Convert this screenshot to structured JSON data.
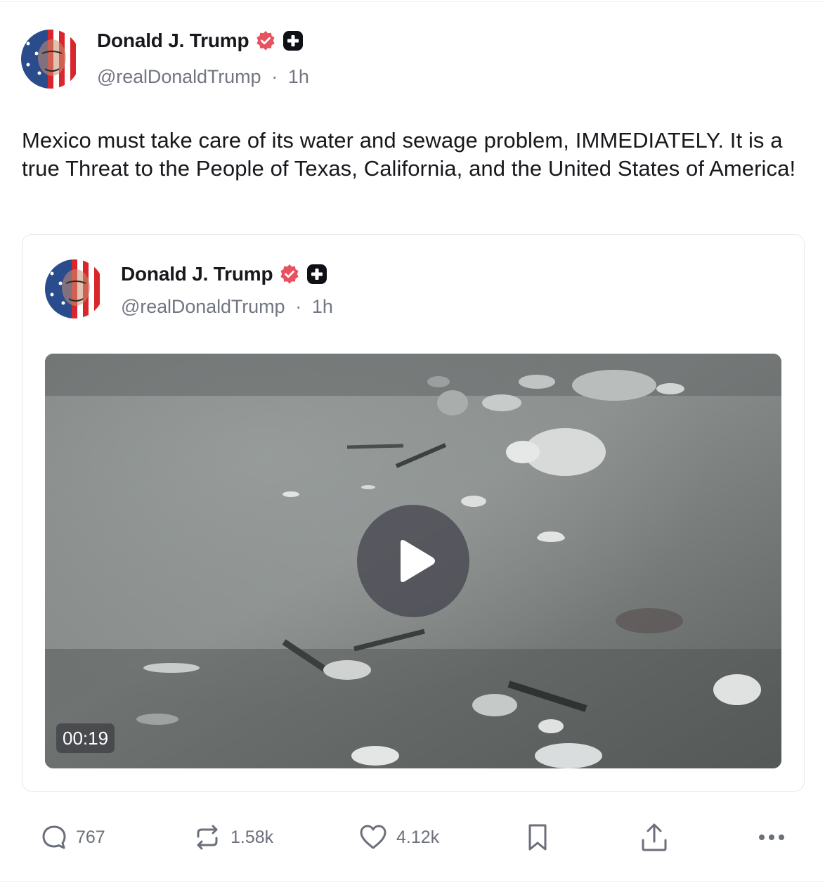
{
  "post": {
    "author_name": "Donald J. Trump",
    "handle": "@realDonaldTrump",
    "separator": "·",
    "time": "1h",
    "text": "Mexico must take care of its water and sewage problem, IMMEDIATELY. It is a true Threat to the People of Texas, California, and the United States of America!",
    "avatar_icon": "flag-face-avatar",
    "verified_icon": "verified-badge-icon",
    "plus_icon": "plus-badge-icon"
  },
  "quoted_post": {
    "author_name": "Donald J. Trump",
    "handle": "@realDonaldTrump",
    "separator": "·",
    "time": "1h",
    "video": {
      "duration": "00:19",
      "play_icon": "play-icon"
    }
  },
  "actions": {
    "replies": {
      "icon": "reply-icon",
      "count": "767"
    },
    "reposts": {
      "icon": "repost-icon",
      "count": "1.58k"
    },
    "likes": {
      "icon": "heart-icon",
      "count": "4.12k"
    },
    "bookmark": {
      "icon": "bookmark-icon"
    },
    "share": {
      "icon": "share-icon"
    },
    "more": {
      "icon": "more-icon"
    }
  },
  "colors": {
    "verified_badge": "#e8515f",
    "text_primary": "#17181c",
    "text_secondary": "#727683",
    "action_gray": "#6b6f7a"
  }
}
